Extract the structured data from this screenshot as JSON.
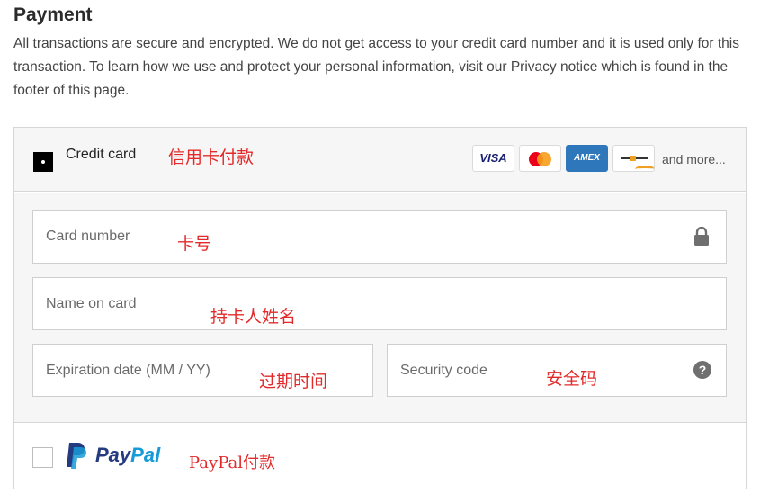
{
  "payment": {
    "title": "Payment",
    "description": "All transactions are secure and encrypted. We do not get access to your credit card number and it is used only for this transaction. To learn how we use and protect your personal information, visit our Privacy notice which is found in the footer of this page."
  },
  "credit_card": {
    "label": "Credit card",
    "annotation": "信用卡付款",
    "card_logos": [
      {
        "name": "visa",
        "text": "VISA"
      },
      {
        "name": "mastercard",
        "text": ""
      },
      {
        "name": "amex",
        "text": "AMEX"
      },
      {
        "name": "generic-card",
        "text": ""
      }
    ],
    "and_more": "and more...",
    "selected": true
  },
  "fields": {
    "card_number": {
      "placeholder": "Card number",
      "annotation": "卡号",
      "value": ""
    },
    "name_on_card": {
      "placeholder": "Name on card",
      "annotation": "持卡人姓名",
      "value": ""
    },
    "expiration": {
      "placeholder": "Expiration date (MM / YY)",
      "annotation": "过期时间",
      "value": ""
    },
    "security_code": {
      "placeholder": "Security code",
      "annotation": "安全码",
      "value": "",
      "help_glyph": "?"
    }
  },
  "paypal": {
    "logo_pay": "Pay",
    "logo_pal": "Pal",
    "annotation": "PayPal付款",
    "selected": false
  },
  "icons": {
    "lock": "lock-icon",
    "help": "question-circle-icon"
  },
  "colors": {
    "annotation_red": "#e32a2a",
    "paypal_dark": "#253b80",
    "paypal_light": "#179bd7",
    "visa_blue": "#1a1f71",
    "amex_blue": "#2e77bb"
  }
}
